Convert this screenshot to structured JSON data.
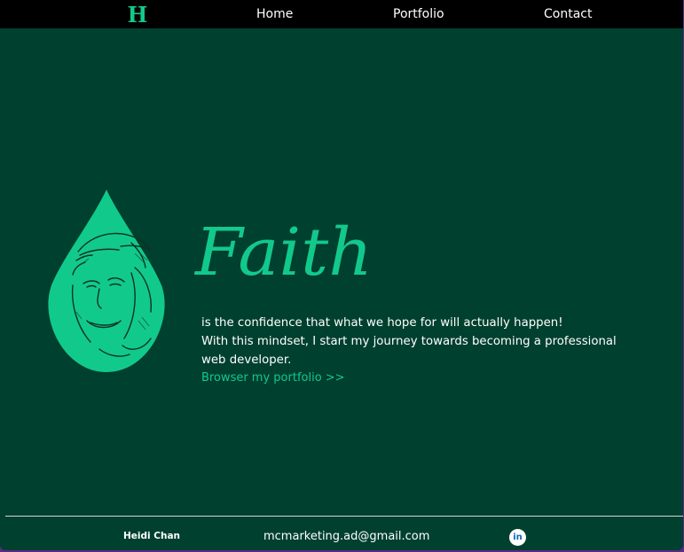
{
  "nav": {
    "logo_letter": "H",
    "links": [
      {
        "label": "Home"
      },
      {
        "label": "Portfolio"
      },
      {
        "label": "Contact"
      }
    ]
  },
  "hero": {
    "title": "Faith",
    "lines": [
      "is the confidence that what we hope for will actually happen!",
      "With this mindset, I start my journey towards becoming a professional web developer."
    ],
    "cta_label": "Browser my portfolio >>",
    "illustration_icon": "water-drop-portrait"
  },
  "footer": {
    "name": "Heidi Chan",
    "email": "mcmarketing.ad@gmail.com",
    "social_icon": "linkedin-icon",
    "social_label": "in"
  },
  "colors": {
    "background": "#00402e",
    "accent": "#12c98c",
    "navbar": "#000000",
    "text": "#ffffff"
  }
}
